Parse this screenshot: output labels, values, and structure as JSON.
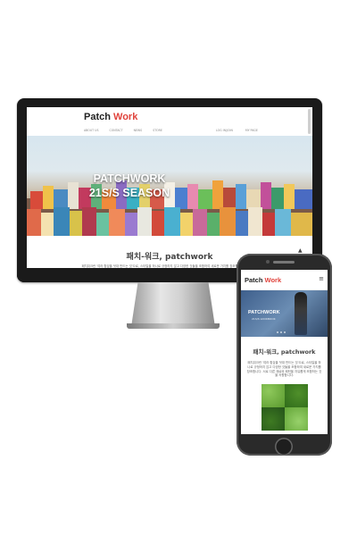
{
  "desktop": {
    "logo": {
      "prefix": "Patch ",
      "highlight": "Work"
    },
    "nav_left": [
      "ABOUT US",
      "CONTACT",
      "NEWS",
      "STORE"
    ],
    "nav_right": [
      "LOG IN/JOIN",
      "MY PAGE"
    ],
    "hero_title": "PATCHWORK\n21S/S SEASON",
    "section_title": "패치-워크, patchwork",
    "body_text": "패치워크란 '여러 헝겊을 덧대 만드는 것'으로, 스타일을 하나로 규정하지 않고 다양한 것들을 조합하여 새로운 가치를 창조합니다. 서로 다른 재료와 패턴을 자유롭게 조합하는 것을 지향합니다.",
    "arrow_up": "▲",
    "arrow_down": "▼",
    "apple_symbol": ""
  },
  "mobile": {
    "logo": {
      "prefix": "Patch ",
      "highlight": "Work"
    },
    "menu_symbol": "≡",
    "hero_title": "PATCHWORK",
    "hero_subtitle": "21S/S LOOKBOOK",
    "section_title": "패치-워크, patchwork",
    "body_text": "패치워크란 '여러 헝겊을 덧대 만드는 것'으로, 스타일을 하나로 규정하지 않고 다양한 것들을 조합하여 새로운 가치를 창조합니다. 서로 다른 재료와 패턴을 자유롭게 조합하는 것을 지향합니다."
  },
  "colors": {
    "logo_accent": "#e0433c",
    "device_bezel": "#1a1a1a",
    "text_dark": "#444444"
  }
}
